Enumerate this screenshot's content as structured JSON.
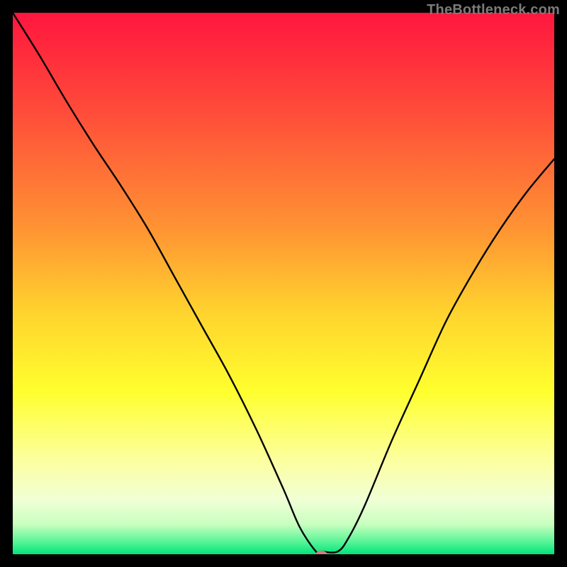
{
  "watermark": "TheBottleneck.com",
  "chart_data": {
    "type": "line",
    "title": "",
    "xlabel": "",
    "ylabel": "",
    "xlim": [
      0,
      100
    ],
    "ylim": [
      0,
      100
    ],
    "series": [
      {
        "name": "bottleneck-curve",
        "x": [
          0,
          5,
          10,
          15,
          20,
          25,
          30,
          35,
          40,
          45,
          50,
          53,
          56,
          57,
          60,
          62,
          65,
          70,
          75,
          80,
          85,
          90,
          95,
          100
        ],
        "y": [
          100,
          92,
          83.5,
          75.5,
          68,
          60,
          51,
          42,
          33,
          23,
          12,
          5,
          0.5,
          0.5,
          0.5,
          3,
          9,
          21,
          32,
          43,
          52,
          60,
          67,
          73
        ]
      }
    ],
    "marker": {
      "name": "optimal-point",
      "x": 57,
      "y": 0,
      "color": "#db7b78",
      "rx": 8,
      "ry": 5
    },
    "gradient_stops": [
      {
        "offset": 0.0,
        "color": "#ff163e"
      },
      {
        "offset": 0.18,
        "color": "#ff4b3a"
      },
      {
        "offset": 0.4,
        "color": "#ff9433"
      },
      {
        "offset": 0.55,
        "color": "#ffd22e"
      },
      {
        "offset": 0.7,
        "color": "#ffff2e"
      },
      {
        "offset": 0.83,
        "color": "#fcffa2"
      },
      {
        "offset": 0.9,
        "color": "#f0ffd6"
      },
      {
        "offset": 0.945,
        "color": "#c7ffbf"
      },
      {
        "offset": 0.975,
        "color": "#60f59a"
      },
      {
        "offset": 1.0,
        "color": "#00e47a"
      }
    ]
  }
}
